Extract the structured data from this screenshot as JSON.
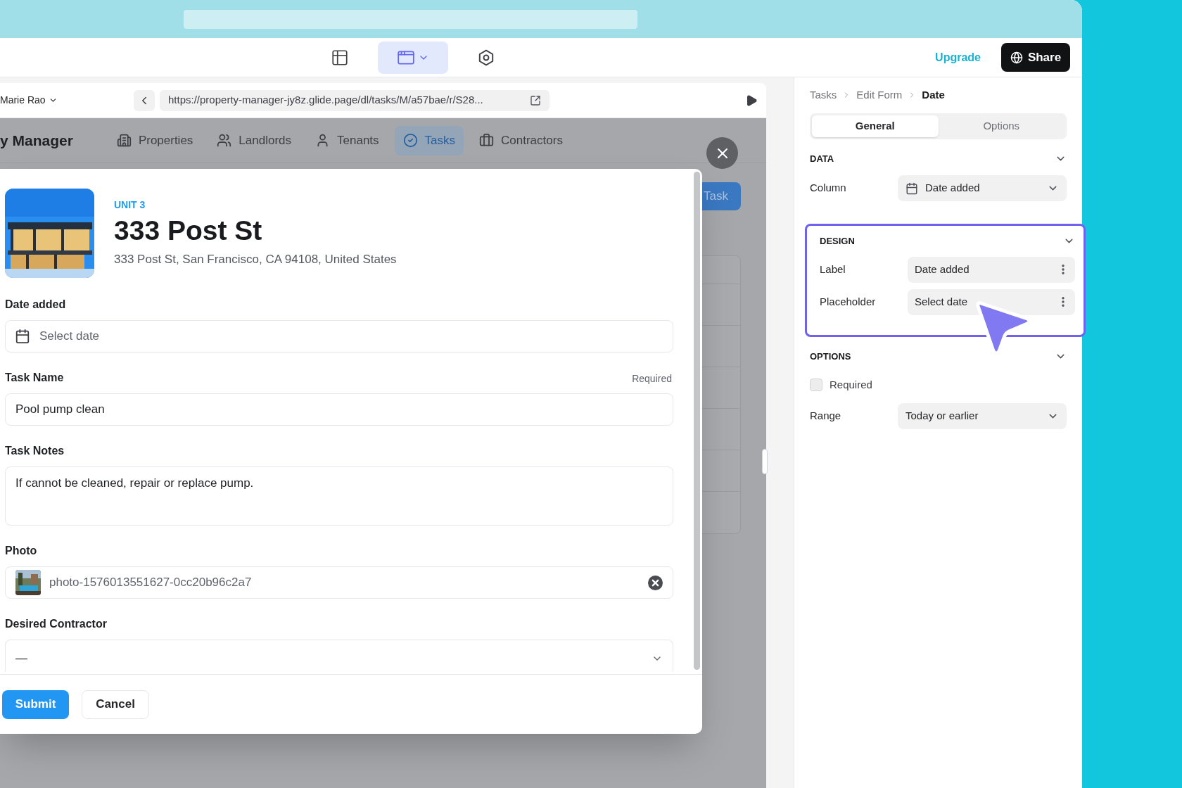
{
  "toolbar": {
    "views": [
      {
        "kind": "data",
        "selected": false
      },
      {
        "kind": "layout",
        "selected": true
      },
      {
        "kind": "settings",
        "selected": false
      }
    ],
    "upgrade": "Upgrade",
    "share": "Share"
  },
  "preview": {
    "user": "Marie Rao",
    "url": "https://property-manager-jy8z.glide.page/dl/tasks/M/a57bae/r/S28...",
    "app_title": "y Manager",
    "nav": [
      {
        "label": "Properties",
        "selected": false
      },
      {
        "label": "Landlords",
        "selected": false
      },
      {
        "label": "Tenants",
        "selected": false
      },
      {
        "label": "Tasks",
        "selected": true
      },
      {
        "label": "Contractors",
        "selected": false
      }
    ],
    "background_button": "Task"
  },
  "form": {
    "unit": "UNIT 3",
    "title": "333 Post St",
    "address": "333 Post St, San Francisco, CA 94108, United States",
    "fields": [
      {
        "kind": "date",
        "label": "Date added",
        "placeholder": "Select date"
      },
      {
        "kind": "text",
        "label": "Task Name",
        "note": "Required",
        "value": "Pool pump clean"
      },
      {
        "kind": "textarea",
        "label": "Task Notes",
        "value": "If cannot be cleaned, repair or replace pump."
      },
      {
        "kind": "file",
        "label": "Photo",
        "value": "photo-1576013551627-0cc20b96c2a7"
      },
      {
        "kind": "select",
        "label": "Desired Contractor",
        "value": "—"
      }
    ],
    "submit": "Submit",
    "cancel": "Cancel"
  },
  "inspector": {
    "breadcrumb": [
      {
        "label": "Tasks",
        "current": false
      },
      {
        "label": "Edit Form",
        "current": false
      },
      {
        "label": "Date",
        "current": true
      }
    ],
    "tabs": [
      {
        "label": "General",
        "selected": true
      },
      {
        "label": "Options",
        "selected": false
      }
    ],
    "sections": [
      {
        "title": "DATA",
        "highlighted": false,
        "rows": [
          {
            "kind": "select",
            "label": "Column",
            "value": "Date added",
            "icon": true
          }
        ]
      },
      {
        "title": "DESIGN",
        "highlighted": true,
        "rows": [
          {
            "kind": "text",
            "label": "Label",
            "value": "Date added"
          },
          {
            "kind": "text",
            "label": "Placeholder",
            "value": "Select date"
          }
        ]
      },
      {
        "title": "OPTIONS",
        "highlighted": false,
        "rows": [
          {
            "kind": "checkbox",
            "label": "Required",
            "checked": false
          },
          {
            "kind": "select",
            "label": "Range",
            "value": "Today or earlier",
            "icon": false
          }
        ]
      }
    ]
  }
}
